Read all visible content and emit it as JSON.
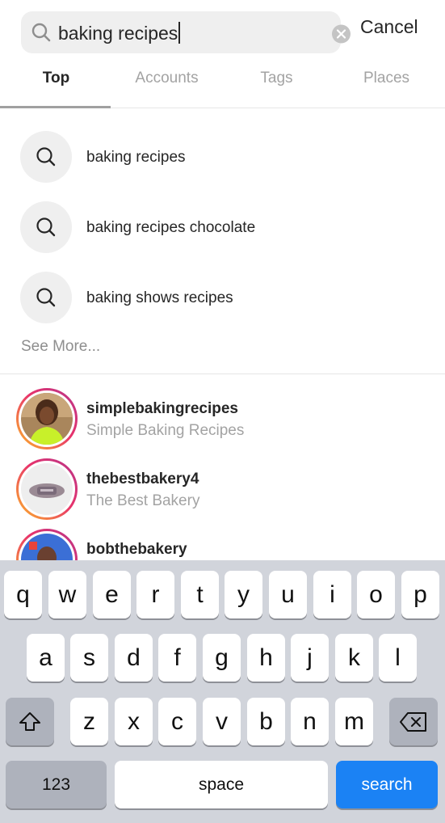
{
  "search": {
    "query": "baking recipes",
    "cancel_label": "Cancel"
  },
  "tabs": [
    {
      "label": "Top",
      "active": true
    },
    {
      "label": "Accounts",
      "active": false
    },
    {
      "label": "Tags",
      "active": false
    },
    {
      "label": "Places",
      "active": false
    }
  ],
  "suggestions": [
    {
      "text": "baking recipes",
      "icon": "search-icon"
    },
    {
      "text": "baking recipes chocolate",
      "icon": "search-icon"
    },
    {
      "text": "baking shows recipes",
      "icon": "search-icon"
    }
  ],
  "see_more_label": "See More...",
  "accounts": [
    {
      "username": "simplebakingrecipes",
      "full_name": "Simple Baking Recipes"
    },
    {
      "username": "thebestbakery4",
      "full_name": "The Best Bakery"
    },
    {
      "username": "bobthebakery",
      "full_name": ""
    }
  ],
  "keyboard": {
    "row1": [
      "q",
      "w",
      "e",
      "r",
      "t",
      "y",
      "u",
      "i",
      "o",
      "p"
    ],
    "row2": [
      "a",
      "s",
      "d",
      "f",
      "g",
      "h",
      "j",
      "k",
      "l"
    ],
    "row3": [
      "z",
      "x",
      "c",
      "v",
      "b",
      "n",
      "m"
    ],
    "shift_icon": "shift-icon",
    "backspace_icon": "backspace-icon",
    "numbers_label": "123",
    "space_label": "space",
    "search_label": "search"
  },
  "colors": {
    "accent": "#1b82f4",
    "keyboard_bg": "#d1d4db",
    "muted_text": "#a3a3a3"
  }
}
